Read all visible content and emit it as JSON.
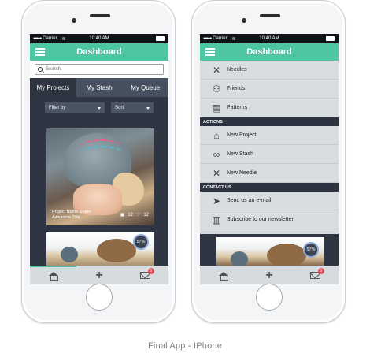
{
  "caption": "Final App - IPhone",
  "status": {
    "carrier": "Carrier",
    "time": "10:40 AM"
  },
  "app": {
    "title": "Dashboard"
  },
  "left": {
    "search": {
      "placeholder": "Search"
    },
    "tabs": [
      {
        "label": "My Projects",
        "active": true
      },
      {
        "label": "My Stash",
        "active": false
      },
      {
        "label": "My Queue",
        "active": false
      }
    ],
    "filters": {
      "filter_label": "Filter by",
      "sort_label": "Sort"
    },
    "card": {
      "title": "Project Name Super Awesome Title",
      "photos": "12",
      "likes": "12"
    },
    "card2": {
      "progress": "57%"
    }
  },
  "bottom_nav": {
    "notifications": "3"
  },
  "right": {
    "menu": [
      {
        "label": "Needles",
        "icon": "needles-icon"
      },
      {
        "label": "Friends",
        "icon": "friends-icon"
      },
      {
        "label": "Patterns",
        "icon": "patterns-icon"
      }
    ],
    "actions_header": "ACTIONS",
    "actions": [
      {
        "label": "New Project",
        "icon": "new-project-icon"
      },
      {
        "label": "New Stash",
        "icon": "new-stash-icon"
      },
      {
        "label": "New Needle",
        "icon": "new-needle-icon"
      }
    ],
    "contact_header": "CONTACT US",
    "contact": [
      {
        "label": "Send us an e-mail",
        "icon": "send-icon"
      },
      {
        "label": "Subscribe to our newsletter",
        "icon": "newsletter-icon"
      }
    ],
    "peek_progress": "57%"
  },
  "colors": {
    "accent": "#4ec6a2",
    "dark": "#2f3543",
    "tab_bg": "#46505e",
    "notification": "#e74c5a"
  }
}
